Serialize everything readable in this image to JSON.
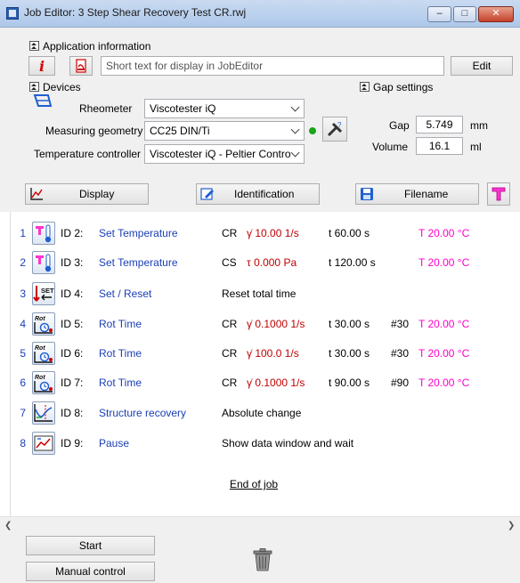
{
  "window": {
    "title": "Job Editor: 3 Step Shear Recovery Test CR.rwj",
    "minimize": "–",
    "maximize": "□",
    "close": "✕"
  },
  "app_info": {
    "header": "Application information",
    "text_placeholder": "Short text for display in JobEditor",
    "edit_label": "Edit"
  },
  "devices": {
    "header": "Devices",
    "rheometer_label": "Rheometer",
    "rheometer_value": "Viscotester iQ",
    "geometry_label": "Measuring geometry",
    "geometry_value": "CC25 DIN/Ti",
    "temp_ctrl_label": "Temperature controller",
    "temp_ctrl_value": "Viscotester iQ - Peltier Contro"
  },
  "gap": {
    "header": "Gap settings",
    "gap_label": "Gap",
    "gap_value": "5.749",
    "gap_unit": "mm",
    "volume_label": "Volume",
    "volume_value": "16.1",
    "volume_unit": "ml"
  },
  "toolbar": {
    "display_label": "Display",
    "identification_label": "Identification",
    "filename_label": "Filename"
  },
  "job_steps": [
    {
      "n": "1",
      "icon": "set-temperature-icon",
      "id": "ID 2:",
      "name": "Set Temperature",
      "mode": "CR",
      "value": "γ̇ 10.00 1/s",
      "time": "t 60.00 s",
      "points": "",
      "temp": "T 20.00 °C"
    },
    {
      "n": "2",
      "icon": "set-temperature-icon",
      "id": "ID 3:",
      "name": "Set Temperature",
      "mode": "CS",
      "value": "τ 0.000 Pa",
      "time": "t 120.00 s",
      "points": "",
      "temp": "T 20.00 °C"
    },
    {
      "n": "3",
      "icon": "set-reset-icon",
      "id": "ID 4:",
      "name": "Set / Reset",
      "desc": "Reset total time"
    },
    {
      "n": "4",
      "icon": "rot-time-icon",
      "id": "ID 5:",
      "name": "Rot Time",
      "mode": "CR",
      "value": "γ̇ 0.1000 1/s",
      "time": "t 30.00 s",
      "points": "#30",
      "temp": "T 20.00 °C"
    },
    {
      "n": "5",
      "icon": "rot-time-icon",
      "id": "ID 6:",
      "name": "Rot Time",
      "mode": "CR",
      "value": "γ̇ 100.0 1/s",
      "time": "t 30.00 s",
      "points": "#30",
      "temp": "T 20.00 °C"
    },
    {
      "n": "6",
      "icon": "rot-time-icon",
      "id": "ID 7:",
      "name": "Rot Time",
      "mode": "CR",
      "value": "γ̇ 0.1000 1/s",
      "time": "t 90.00 s",
      "points": "#90",
      "temp": "T 20.00 °C"
    },
    {
      "n": "7",
      "icon": "structure-recovery-icon",
      "id": "ID 8:",
      "name": "Structure recovery",
      "desc": "Absolute change"
    },
    {
      "n": "8",
      "icon": "pause-icon",
      "id": "ID 9:",
      "name": "Pause",
      "desc": "Show data window and wait"
    }
  ],
  "end_of_job": "End of job",
  "rot_icon_text": "Rot",
  "set_icon_text": "SET",
  "buttons": {
    "start": "Start",
    "manual_control": "Manual control"
  },
  "colors": {
    "step_name": "#1a3fb5",
    "value_red": "#c00000",
    "temperature_magenta": "#ff00cc"
  }
}
